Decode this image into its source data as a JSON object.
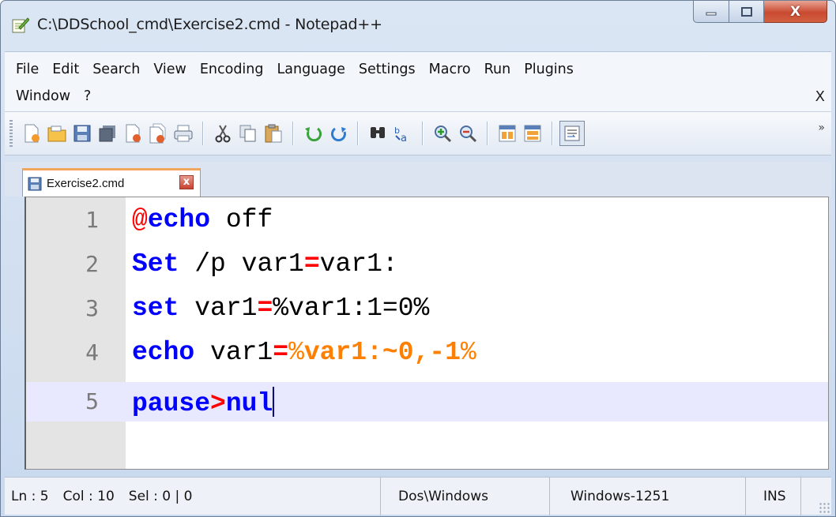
{
  "window": {
    "title": "C:\\DDSchool_cmd\\Exercise2.cmd - Notepad++",
    "close_label": "X"
  },
  "menu": {
    "items_row1": [
      "File",
      "Edit",
      "Search",
      "View",
      "Encoding",
      "Language",
      "Settings",
      "Macro",
      "Run",
      "Plugins"
    ],
    "items_row2": [
      "Window",
      "?"
    ],
    "close_doc": "X"
  },
  "toolbar": {
    "icons": [
      "new-file-icon",
      "open-file-icon",
      "save-icon",
      "save-all-icon",
      "close-icon",
      "close-all-icon",
      "print-icon",
      "cut-icon",
      "copy-icon",
      "paste-icon",
      "undo-icon",
      "redo-icon",
      "find-icon",
      "replace-icon",
      "zoom-in-icon",
      "zoom-out-icon",
      "sync-vertical-icon",
      "sync-horizontal-icon",
      "word-wrap-icon"
    ],
    "more": "»"
  },
  "tabs": [
    {
      "label": "Exercise2.cmd",
      "close": "x"
    }
  ],
  "editor": {
    "lines": [
      {
        "number": "1",
        "text": "@echo off"
      },
      {
        "number": "2",
        "text": "Set /p var1=var1:"
      },
      {
        "number": "3",
        "text": "set var1=%var1:1=0%"
      },
      {
        "number": "4",
        "text": "echo var1=%var1:~0,-1%"
      },
      {
        "number": "5",
        "text": "pause>nul"
      }
    ],
    "current_line": 5
  },
  "statusbar": {
    "ln": "Ln : 5",
    "col": "Col : 10",
    "sel": "Sel : 0 | 0",
    "eol": "Dos\\Windows",
    "encoding": "Windows-1251",
    "mode": "INS"
  }
}
